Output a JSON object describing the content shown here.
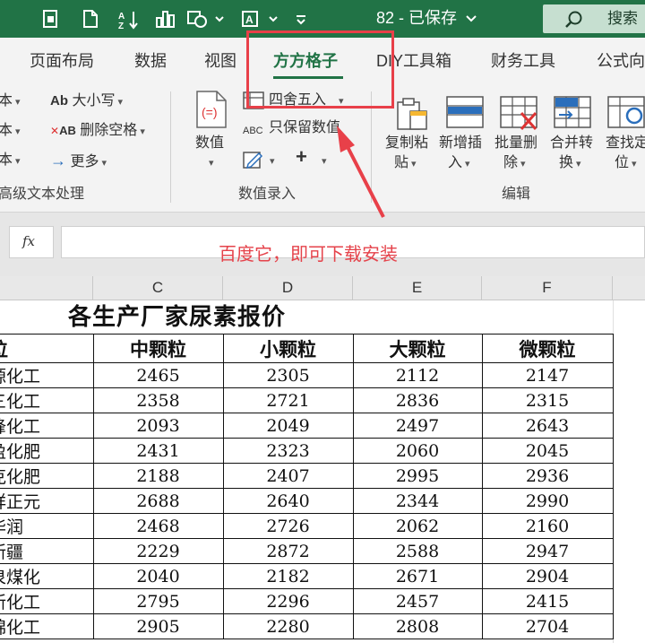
{
  "titlebar": {
    "doc_title": "82 - 已保存",
    "search_label": "搜索"
  },
  "tabs": [
    "页面布局",
    "数据",
    "视图",
    "方方格子",
    "DIY工具箱",
    "财务工具",
    "公式向"
  ],
  "active_tab": "方方格子",
  "ribbon": {
    "text_group": {
      "items": [
        {
          "prefix": "本",
          "chev": "⌄"
        },
        {
          "prefix": "本",
          "chev": "⌄"
        },
        {
          "prefix": "本",
          "chev": "⌄"
        }
      ],
      "case_label": "大小写",
      "case_icon_text": "Ab",
      "trim_label": "删除空格",
      "trim_icon_text": "AB",
      "more_label": "更多",
      "group_label": "高级文本处理"
    },
    "value_group": {
      "value_button": "数值",
      "round_label": "四舍五入",
      "keep_values_label": "只保留数值",
      "keep_values_icon_text": "ABC",
      "group_label": "数值录入"
    },
    "edit_group": {
      "buttons": [
        {
          "line1": "复制粘",
          "line2": "贴"
        },
        {
          "line1": "新增插",
          "line2": "入"
        },
        {
          "line1": "批量删",
          "line2": "除"
        },
        {
          "line1": "合并转",
          "line2": "换"
        },
        {
          "line1": "查找定",
          "line2": "位"
        }
      ],
      "group_label": "编辑"
    }
  },
  "formula_bar": {
    "fx_label": "fx",
    "value": ""
  },
  "annotation": "百度它，即可下载安装",
  "columns": [
    "C",
    "D",
    "E",
    "F"
  ],
  "sheet": {
    "title": "各生产厂家尿素报价",
    "headers": [
      "位",
      "中颗粒",
      "小颗粒",
      "大颗粒",
      "微颗粒"
    ],
    "rows": [
      {
        "name": "源化工",
        "c": "2465",
        "d": "2305",
        "e": "2112",
        "f": "2147"
      },
      {
        "name": "三化工",
        "c": "2358",
        "d": "2721",
        "e": "2836",
        "f": "2315"
      },
      {
        "name": "锋化工",
        "c": "2093",
        "d": "2049",
        "e": "2497",
        "f": "2643"
      },
      {
        "name": "盈化肥",
        "c": "2431",
        "d": "2323",
        "e": "2060",
        "f": "2045"
      },
      {
        "name": "克化肥",
        "c": "2188",
        "d": "2407",
        "e": "2995",
        "f": "2936"
      },
      {
        "name": "祥正元",
        "c": "2688",
        "d": "2640",
        "e": "2344",
        "f": "2990"
      },
      {
        "name": "华润",
        "c": "2468",
        "d": "2726",
        "e": "2062",
        "f": "2160"
      },
      {
        "name": "新疆",
        "c": "2229",
        "d": "2872",
        "e": "2588",
        "f": "2947"
      },
      {
        "name": "泉煤化",
        "c": "2040",
        "d": "2182",
        "e": "2671",
        "f": "2904"
      },
      {
        "name": "新化工",
        "c": "2795",
        "d": "2296",
        "e": "2457",
        "f": "2415"
      },
      {
        "name": "锦化工",
        "c": "2905",
        "d": "2280",
        "e": "2808",
        "f": "2704"
      }
    ]
  },
  "colors": {
    "accent_green": "#217346",
    "highlight_red": "#e84049",
    "annotation_red": "#e5434b"
  }
}
